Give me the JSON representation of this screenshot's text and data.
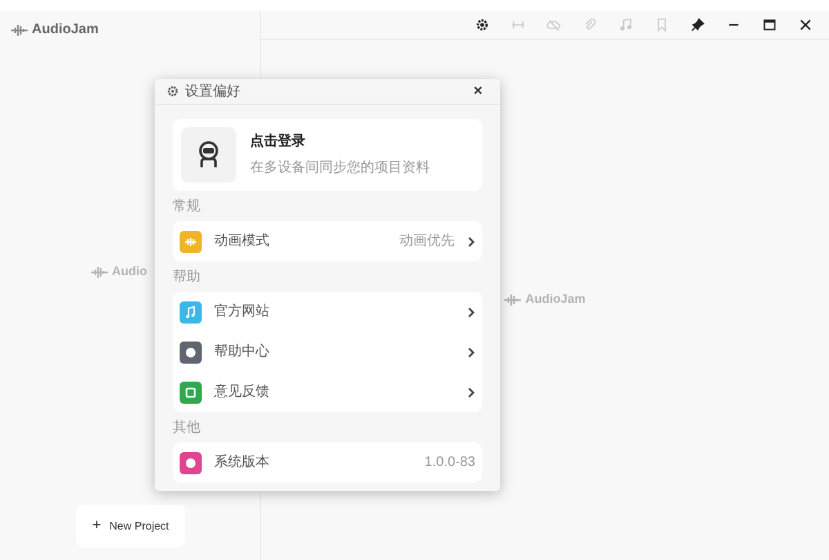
{
  "app": {
    "name": "AudioJam"
  },
  "toolbar": [
    {
      "kind": "gear",
      "disabled": false
    },
    {
      "kind": "link",
      "disabled": true
    },
    {
      "kind": "cloud",
      "disabled": true
    },
    {
      "kind": "clip",
      "disabled": true
    },
    {
      "kind": "note",
      "disabled": true
    },
    {
      "kind": "bookmark",
      "disabled": true
    },
    {
      "kind": "pin",
      "disabled": false
    },
    {
      "kind": "minimize",
      "disabled": false
    },
    {
      "kind": "maximize",
      "disabled": false
    },
    {
      "kind": "close",
      "disabled": false
    }
  ],
  "sidebar": {
    "watermark": "Audio",
    "new_project": {
      "icon": "+",
      "label": "New Project"
    }
  },
  "main": {
    "watermark": "AudioJam"
  },
  "dialog": {
    "title": "设置偏好",
    "close": "×",
    "profile": {
      "title": "点击登录",
      "subtitle": "在多设备间同步您的项目资料"
    },
    "sections": [
      {
        "label": "常规",
        "items": [
          {
            "kind": "wave",
            "color": "#f0b429",
            "label": "动画模式",
            "value": "动画优先",
            "chevron": true
          }
        ]
      },
      {
        "label": "帮助",
        "items": [
          {
            "kind": "note",
            "color": "#3bb7ea",
            "label": "官方网站",
            "chevron": true
          },
          {
            "kind": "help",
            "color": "#5f6670",
            "label": "帮助中心",
            "chevron": true
          },
          {
            "kind": "square",
            "color": "#2fa84f",
            "label": "意见反馈",
            "chevron": true
          }
        ]
      },
      {
        "label": "其他",
        "items": [
          {
            "kind": "info",
            "color": "#e0458f",
            "label": "系统版本",
            "value": "1.0.0-83",
            "chevron": false
          }
        ]
      }
    ]
  }
}
